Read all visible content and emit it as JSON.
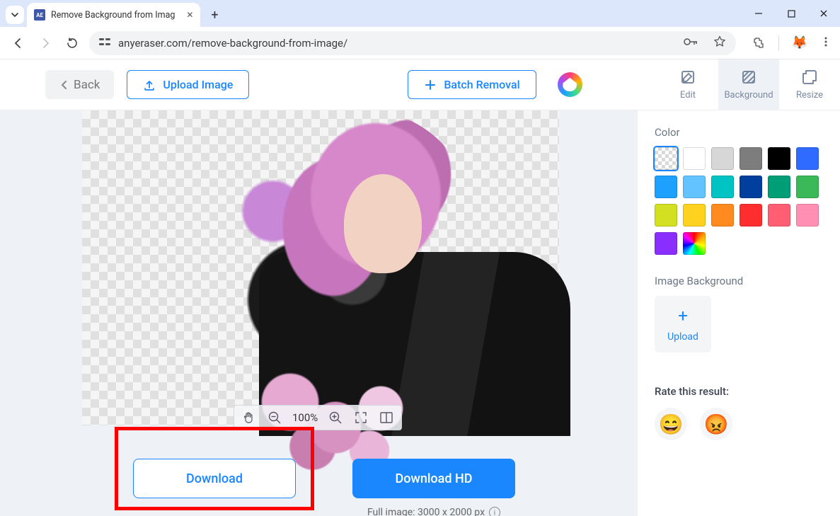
{
  "browser": {
    "tab_title": "Remove Background from Imag",
    "url": "anyeraser.com/remove-background-from-image/"
  },
  "header": {
    "back_label": "Back",
    "upload_label": "Upload Image",
    "batch_label": "Batch Removal",
    "tool_edit": "Edit",
    "tool_background": "Background",
    "tool_resize": "Resize"
  },
  "canvas": {
    "zoom_level": "100%"
  },
  "download": {
    "standard_label": "Download",
    "hd_label": "Download HD",
    "full_meta": "Full image: 3000 x 2000 px"
  },
  "sidebar": {
    "color_label": "Color",
    "colors": [
      "#ffffff",
      "#d7d7d7",
      "#7d7d7d",
      "#000000",
      "#2f6bff",
      "#1ea0ff",
      "#62c3ff",
      "#00c4c4",
      "#003f9e",
      "#009e77",
      "#3bb857",
      "#d3e021",
      "#ffd21f",
      "#ff8a1f",
      "#ff2e2e",
      "#ff5e73",
      "#ff8fb3",
      "#8a2eff"
    ],
    "img_bg_label": "Image Background",
    "upload_label": "Upload",
    "rate_label": "Rate this result:"
  }
}
